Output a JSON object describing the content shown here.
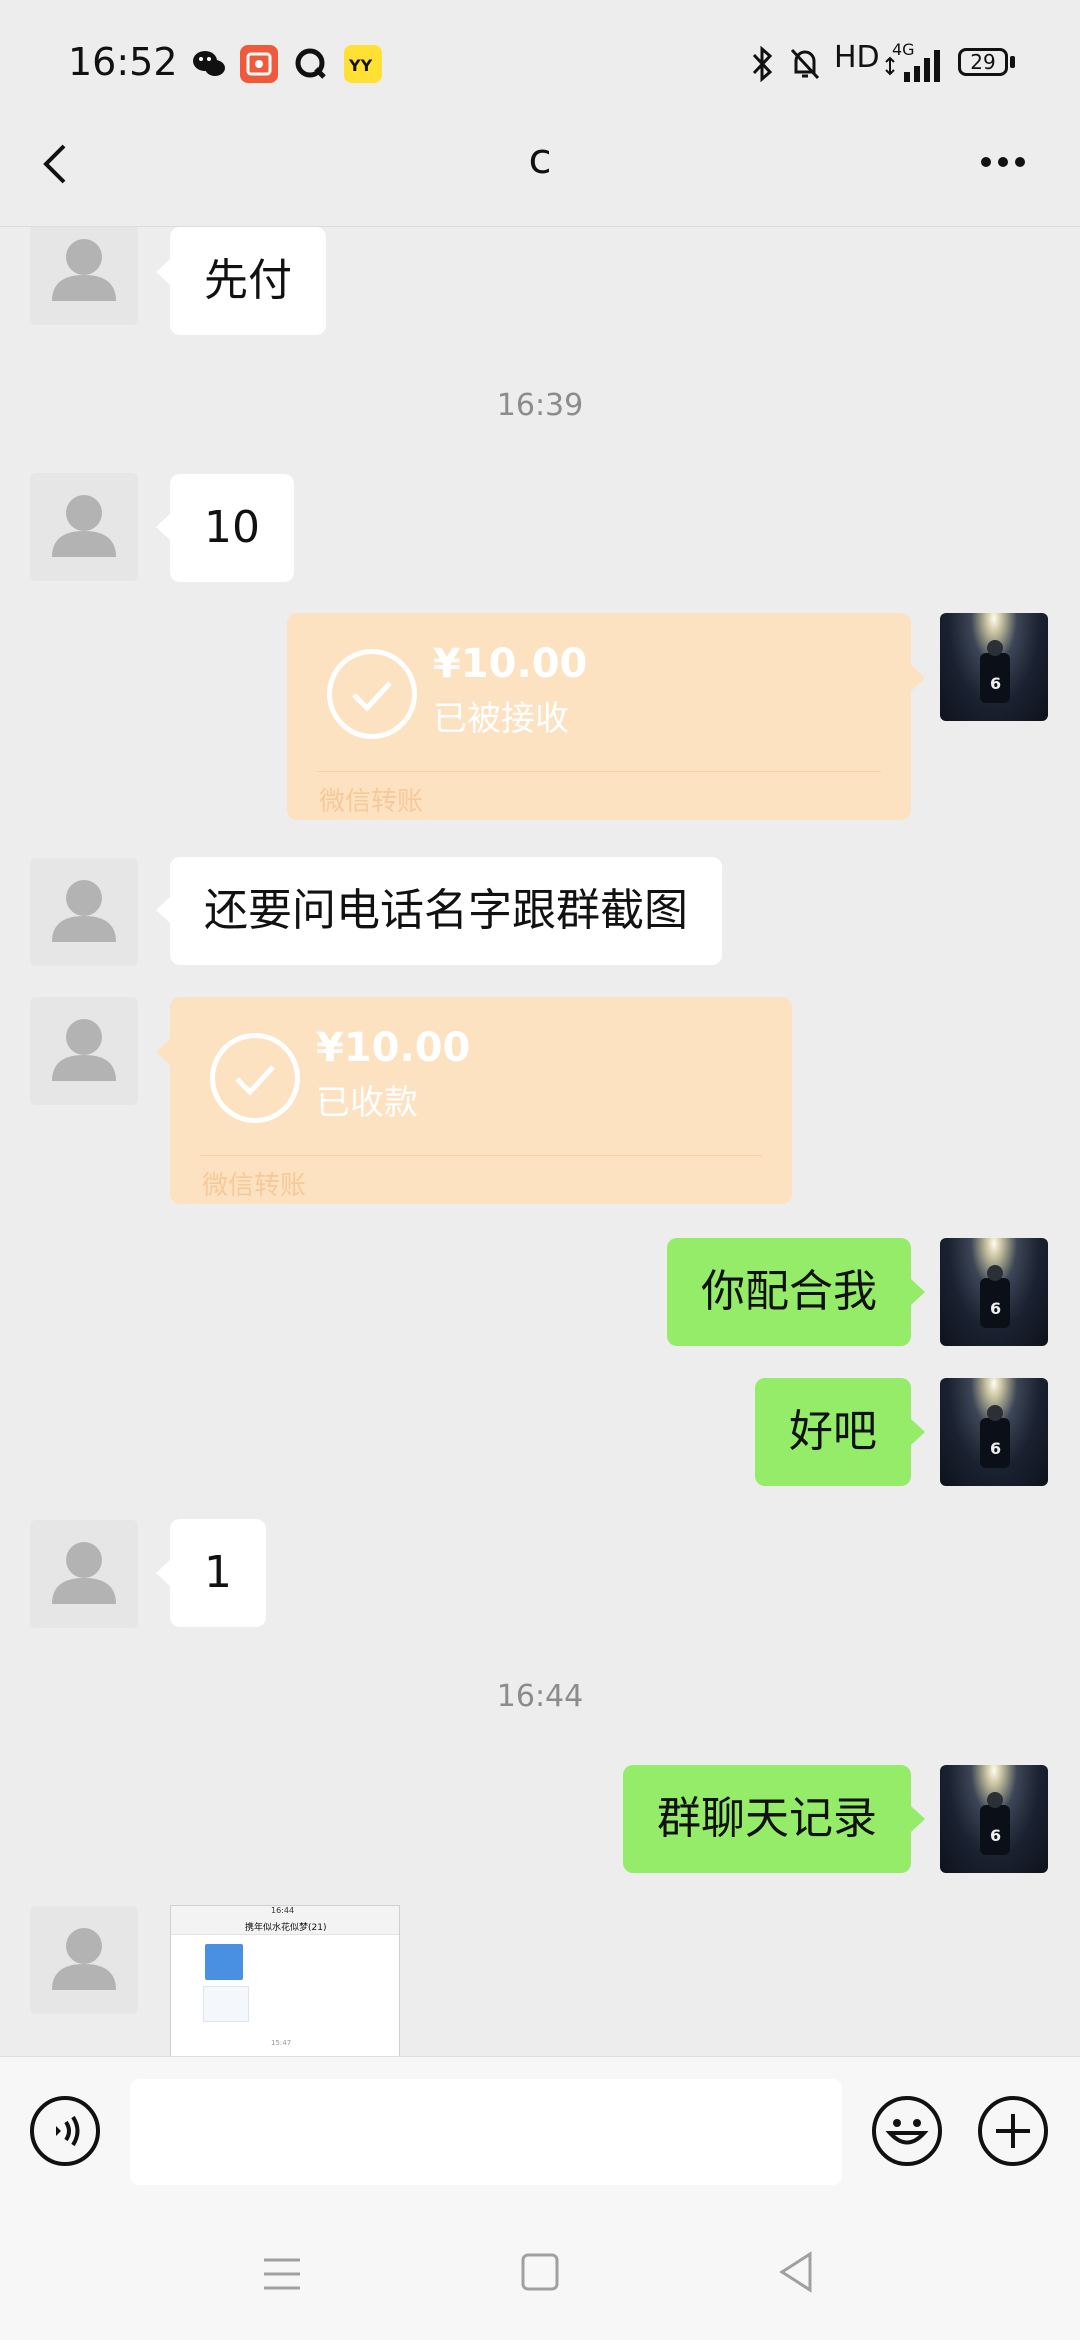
{
  "status_bar": {
    "time": "16:52",
    "hd": "HD",
    "network": "4G",
    "battery": "29",
    "app_icons": [
      "wechat-icon",
      "video-app-icon",
      "qq-icon",
      "yy-icon"
    ]
  },
  "header": {
    "title": "c",
    "back_icon": "chevron-left-icon",
    "more_icon": "more-dots-icon"
  },
  "messages": {
    "m1": "先付",
    "t1": "16:39",
    "m2": "10",
    "transfer1": {
      "amount": "¥10.00",
      "status": "已被接收",
      "label": "微信转账"
    },
    "m3": "还要问电话名字跟群截图",
    "transfer2": {
      "amount": "¥10.00",
      "status": "已收款",
      "label": "微信转账"
    },
    "m4": "你配合我",
    "m5": "好吧",
    "m6": "1",
    "t2": "16:44",
    "m7": "群聊天记录",
    "image_thumb": {
      "title": "携年似水花似梦(21)",
      "time": "16:44",
      "ts": "15:47"
    }
  },
  "input_bar": {
    "placeholder": "",
    "voice_icon": "voice-icon",
    "emoji_icon": "emoji-icon",
    "plus_icon": "plus-icon"
  },
  "colors": {
    "background": "#ededed",
    "bubble_self": "#95ec69",
    "bubble_other": "#ffffff",
    "transfer": "#fde2c2"
  }
}
